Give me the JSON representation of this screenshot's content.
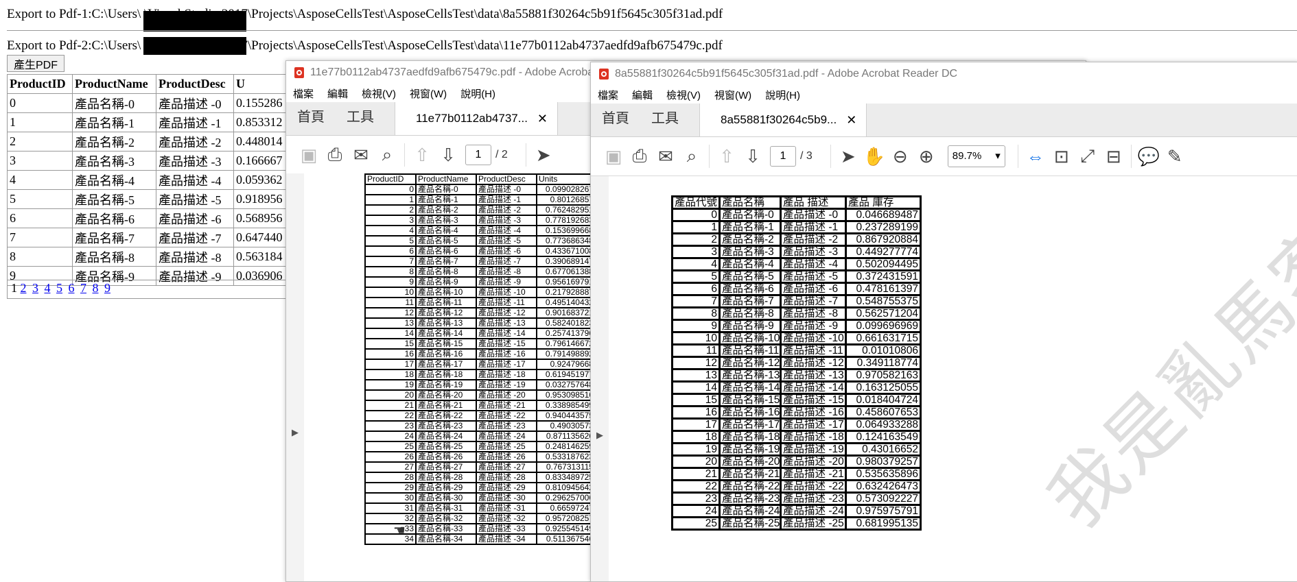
{
  "page": {
    "export1": "Export to Pdf-1:C:\\Users\\                   \\Visual Studio 2017\\Projects\\AsposeCellsTest\\AsposeCellsTest\\data\\8a55881f30264c5b91f5645c305f31ad.pdf",
    "export2": "Export to Pdf-2:C:\\Users\\                   \\Visual Studio 2017\\Projects\\AsposeCellsTest\\AsposeCellsTest\\data\\11e77b0112ab4737aedfd9afb675479c.pdf",
    "generate_button": "產生PDF",
    "grid_headers": [
      "ProductID",
      "ProductName",
      "ProductDesc",
      "U"
    ],
    "grid_rows": [
      [
        "0",
        "產品名稱-0",
        "產品描述 -0",
        "0.155286"
      ],
      [
        "1",
        "產品名稱-1",
        "產品描述 -1",
        "0.853312"
      ],
      [
        "2",
        "產品名稱-2",
        "產品描述 -2",
        "0.448014"
      ],
      [
        "3",
        "產品名稱-3",
        "產品描述 -3",
        "0.166667"
      ],
      [
        "4",
        "產品名稱-4",
        "產品描述 -4",
        "0.059362"
      ],
      [
        "5",
        "產品名稱-5",
        "產品描述 -5",
        "0.918956"
      ],
      [
        "6",
        "產品名稱-6",
        "產品描述 -6",
        "0.568956"
      ],
      [
        "7",
        "產品名稱-7",
        "產品描述 -7",
        "0.647440"
      ],
      [
        "8",
        "產品名稱-8",
        "產品描述 -8",
        "0.563184"
      ],
      [
        "9",
        "產品名稱-9",
        "產品描述 -9",
        "0.036906"
      ]
    ],
    "pager_current": "1",
    "pager_links": [
      "2",
      "3",
      "4",
      "5",
      "6",
      "7",
      "8",
      "9"
    ]
  },
  "viewer1": {
    "title": "11e77b0112ab4737aedfd9afb675479c.pdf - Adobe Acrobat R",
    "menu": [
      "檔案",
      "編輯",
      "檢視(V)",
      "視窗(W)",
      "說明(H)"
    ],
    "nav": [
      "首頁",
      "工具"
    ],
    "tab": "11e77b0112ab4737...",
    "page_current": "1",
    "page_total": "/ 2",
    "headers": [
      "ProductID",
      "ProductName",
      "ProductDesc",
      "Units"
    ],
    "rows": [
      [
        "0",
        "產品名稱-0",
        "產品描述 -0",
        "0.099028267"
      ],
      [
        "1",
        "產品名稱-1",
        "產品描述 -1",
        "0.80126857"
      ],
      [
        "2",
        "產品名稱-2",
        "產品描述 -2",
        "0.762482951"
      ],
      [
        "3",
        "產品名稱-3",
        "產品描述 -3",
        "0.778192683"
      ],
      [
        "4",
        "產品名稱-4",
        "產品描述 -4",
        "0.153699668"
      ],
      [
        "5",
        "產品名稱-5",
        "產品描述 -5",
        "0.773686348"
      ],
      [
        "6",
        "產品名稱-6",
        "產品描述 -6",
        "0.433671008"
      ],
      [
        "7",
        "產品名稱-7",
        "產品描述 -7",
        "0.390689147"
      ],
      [
        "8",
        "產品名稱-8",
        "產品描述 -8",
        "0.677061388"
      ],
      [
        "9",
        "產品名稱-9",
        "產品描述 -9",
        "0.956169791"
      ],
      [
        "10",
        "產品名稱-10",
        "產品描述 -10",
        "0.217928887"
      ],
      [
        "11",
        "產品名稱-11",
        "產品描述 -11",
        "0.495140432"
      ],
      [
        "12",
        "產品名稱-12",
        "產品描述 -12",
        "0.901683721"
      ],
      [
        "13",
        "產品名稱-13",
        "產品描述 -13",
        "0.582401823"
      ],
      [
        "14",
        "產品名稱-14",
        "產品描述 -14",
        "0.257413796"
      ],
      [
        "15",
        "產品名稱-15",
        "產品描述 -15",
        "0.796146672"
      ],
      [
        "16",
        "產品名稱-16",
        "產品描述 -16",
        "0.791498892"
      ],
      [
        "17",
        "產品名稱-17",
        "產品描述 -17",
        "0.92479668"
      ],
      [
        "18",
        "產品名稱-18",
        "產品描述 -18",
        "0.619451977"
      ],
      [
        "19",
        "產品名稱-19",
        "產品描述 -19",
        "0.032757648"
      ],
      [
        "20",
        "產品名稱-20",
        "產品描述 -20",
        "0.953098516"
      ],
      [
        "21",
        "產品名稱-21",
        "產品描述 -21",
        "0.338985499"
      ],
      [
        "22",
        "產品名稱-22",
        "產品描述 -22",
        "0.940443575"
      ],
      [
        "23",
        "產品名稱-23",
        "產品描述 -23",
        "0.49030573"
      ],
      [
        "24",
        "產品名稱-24",
        "產品描述 -24",
        "0.871135626"
      ],
      [
        "25",
        "產品名稱-25",
        "產品描述 -25",
        "0.248146259"
      ],
      [
        "26",
        "產品名稱-26",
        "產品描述 -26",
        "0.533187623"
      ],
      [
        "27",
        "產品名稱-27",
        "產品描述 -27",
        "0.767313115"
      ],
      [
        "28",
        "產品名稱-28",
        "產品描述 -28",
        "0.833489725"
      ],
      [
        "29",
        "產品名稱-29",
        "產品描述 -29",
        "0.810945642"
      ],
      [
        "30",
        "產品名稱-30",
        "產品描述 -30",
        "0.296257006"
      ],
      [
        "31",
        "產品名稱-31",
        "產品描述 -31",
        "0.66597247"
      ],
      [
        "32",
        "產品名稱-32",
        "產品描述 -32",
        "0.957208257"
      ],
      [
        "33",
        "產品名稱-33",
        "產品描述 -33",
        "0.925545149"
      ],
      [
        "34",
        "產品名稱-34",
        "產品描述 -34",
        "0.511367546"
      ]
    ]
  },
  "viewer2": {
    "title": "8a55881f30264c5b91f5645c305f31ad.pdf - Adobe Acrobat Reader DC",
    "menu": [
      "檔案",
      "編輯",
      "檢視(V)",
      "視窗(W)",
      "說明(H)"
    ],
    "nav": [
      "首頁",
      "工具"
    ],
    "tab": "8a55881f30264c5b9...",
    "page_current": "1",
    "page_total": "/ 3",
    "zoom": "89.7%",
    "headers": [
      "產品代號",
      "產品名稱",
      "產品 描述",
      "產品 庫存"
    ],
    "rows": [
      [
        "0",
        "產品名稱-0",
        "產品描述 -0",
        "0.046689487"
      ],
      [
        "1",
        "產品名稱-1",
        "產品描述 -1",
        "0.237289199"
      ],
      [
        "2",
        "產品名稱-2",
        "產品描述 -2",
        "0.867920884"
      ],
      [
        "3",
        "產品名稱-3",
        "產品描述 -3",
        "0.449277774"
      ],
      [
        "4",
        "產品名稱-4",
        "產品描述 -4",
        "0.502094495"
      ],
      [
        "5",
        "產品名稱-5",
        "產品描述 -5",
        "0.372431591"
      ],
      [
        "6",
        "產品名稱-6",
        "產品描述 -6",
        "0.478161397"
      ],
      [
        "7",
        "產品名稱-7",
        "產品描述 -7",
        "0.548755375"
      ],
      [
        "8",
        "產品名稱-8",
        "產品描述 -8",
        "0.562571204"
      ],
      [
        "9",
        "產品名稱-9",
        "產品描述 -9",
        "0.099696969"
      ],
      [
        "10",
        "產品名稱-10",
        "產品描述 -10",
        "0.661631715"
      ],
      [
        "11",
        "產品名稱-11",
        "產品描述 -11",
        "0.01010806"
      ],
      [
        "12",
        "產品名稱-12",
        "產品描述 -12",
        "0.349118774"
      ],
      [
        "13",
        "產品名稱-13",
        "產品描述 -13",
        "0.970582163"
      ],
      [
        "14",
        "產品名稱-14",
        "產品描述 -14",
        "0.163125055"
      ],
      [
        "15",
        "產品名稱-15",
        "產品描述 -15",
        "0.018404724"
      ],
      [
        "16",
        "產品名稱-16",
        "產品描述 -16",
        "0.458607653"
      ],
      [
        "17",
        "產品名稱-17",
        "產品描述 -17",
        "0.064933288"
      ],
      [
        "18",
        "產品名稱-18",
        "產品描述 -18",
        "0.124163549"
      ],
      [
        "19",
        "產品名稱-19",
        "產品描述 -19",
        "0.43016652"
      ],
      [
        "20",
        "產品名稱-20",
        "產品描述 -20",
        "0.980379257"
      ],
      [
        "21",
        "產品名稱-21",
        "產品描述 -21",
        "0.535635896"
      ],
      [
        "22",
        "產品名稱-22",
        "產品描述 -22",
        "0.632426473"
      ],
      [
        "23",
        "產品名稱-23",
        "產品描述 -23",
        "0.573092227"
      ],
      [
        "24",
        "產品名稱-24",
        "產品描述 -24",
        "0.975975791"
      ],
      [
        "25",
        "產品名稱-25",
        "產品描述 -25",
        "0.681995135"
      ]
    ],
    "watermark": "我是亂馬客!!!"
  }
}
